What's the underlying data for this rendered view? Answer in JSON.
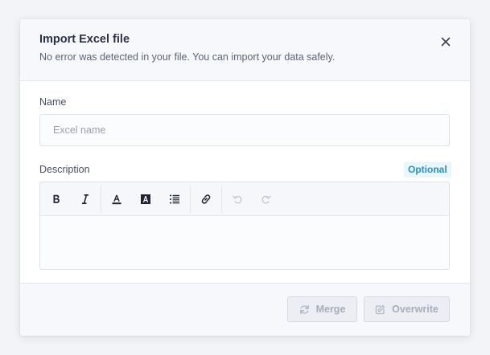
{
  "modal": {
    "title": "Import Excel file",
    "subtitle": "No error was detected in your file. You can import your data safely.",
    "close_icon": "close-icon"
  },
  "form": {
    "name_label": "Name",
    "name_placeholder": "Excel name",
    "name_value": "",
    "description_label": "Description",
    "optional_badge": "Optional",
    "description_value": ""
  },
  "toolbar": {
    "items": [
      {
        "name": "bold",
        "icon": "bold-icon"
      },
      {
        "name": "italic",
        "icon": "italic-icon"
      },
      {
        "name": "text-color",
        "icon": "text-color-icon"
      },
      {
        "name": "highlight",
        "icon": "highlight-icon"
      },
      {
        "name": "list",
        "icon": "ordered-list-icon"
      },
      {
        "name": "link",
        "icon": "link-icon"
      },
      {
        "name": "undo",
        "icon": "undo-icon"
      },
      {
        "name": "redo",
        "icon": "redo-icon"
      }
    ]
  },
  "footer": {
    "merge_label": "Merge",
    "overwrite_label": "Overwrite",
    "buttons_disabled": true
  },
  "colors": {
    "accent": "#2a90c8",
    "title": "#2c3145",
    "disabled_text": "#a7adbb"
  }
}
